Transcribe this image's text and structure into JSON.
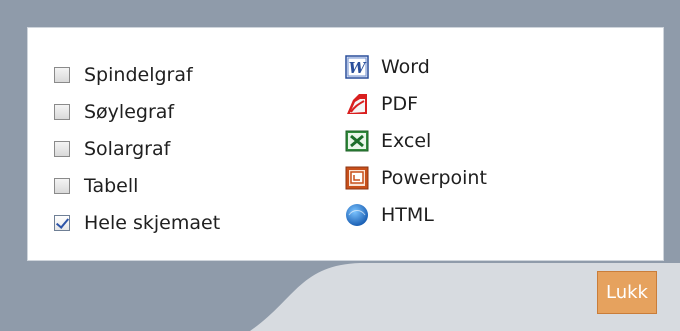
{
  "options": [
    {
      "label": "Spindelgraf",
      "checked": false
    },
    {
      "label": "Søylegraf",
      "checked": false
    },
    {
      "label": "Solargraf",
      "checked": false
    },
    {
      "label": "Tabell",
      "checked": false
    },
    {
      "label": "Hele skjemaet",
      "checked": true
    }
  ],
  "exports": [
    {
      "label": "Word",
      "icon": "word-icon"
    },
    {
      "label": "PDF",
      "icon": "pdf-icon"
    },
    {
      "label": "Excel",
      "icon": "excel-icon"
    },
    {
      "label": "Powerpoint",
      "icon": "powerpoint-icon"
    },
    {
      "label": "HTML",
      "icon": "html-icon"
    }
  ],
  "close_label": "Lukk",
  "colors": {
    "accent": "#e6a25e",
    "frame": "#8f9baa",
    "panel": "#ffffff"
  }
}
